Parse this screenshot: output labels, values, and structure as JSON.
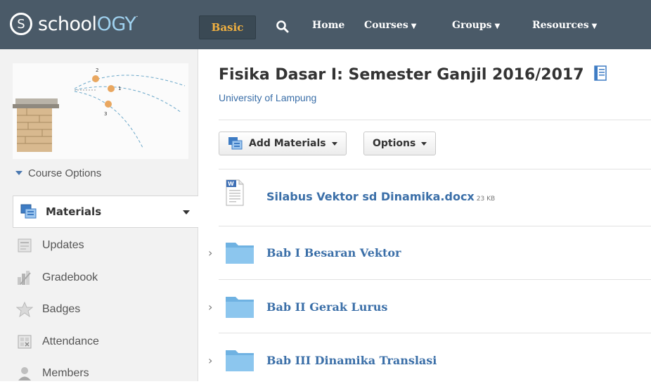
{
  "header": {
    "logo_letter": "S",
    "logo_text_main": "school",
    "logo_text_accent": "OGY",
    "logo_trademark": "·",
    "basic_label": "Basic",
    "nav": [
      {
        "label": "Home",
        "has_caret": false
      },
      {
        "label": "Courses",
        "has_caret": true
      },
      {
        "label": "Groups",
        "has_caret": true
      },
      {
        "label": "Resources",
        "has_caret": true
      }
    ],
    "caret_glyph": "▼"
  },
  "sidebar": {
    "course_options_label": "Course Options",
    "active_item": {
      "label": "Materials",
      "icon": "materials-icon"
    },
    "items": [
      {
        "label": "Updates",
        "icon": "updates-icon"
      },
      {
        "label": "Gradebook",
        "icon": "gradebook-icon"
      },
      {
        "label": "Badges",
        "icon": "badges-icon"
      },
      {
        "label": "Attendance",
        "icon": "attendance-icon"
      },
      {
        "label": "Members",
        "icon": "members-icon"
      }
    ]
  },
  "main": {
    "title": "Fisika Dasar I: Semester Ganjil 2016/2017",
    "subtitle": "University of Lampung",
    "add_materials_label": "Add Materials",
    "options_label": "Options",
    "file": {
      "name": "Silabus Vektor sd Dinamika.docx",
      "size": "23 KB",
      "icon": "word-doc-icon"
    },
    "folders": [
      {
        "name": "Bab I Besaran Vektor"
      },
      {
        "name": "Bab II Gerak Lurus"
      },
      {
        "name": "Bab III Dinamika Translasi"
      }
    ],
    "chevron_glyph": "›"
  },
  "colors": {
    "topbar": "#4a5a68",
    "basic_text": "#f0b040",
    "link": "#3b6fa8",
    "logo_accent": "#9fd1ef",
    "folder": "#7fbde8"
  }
}
